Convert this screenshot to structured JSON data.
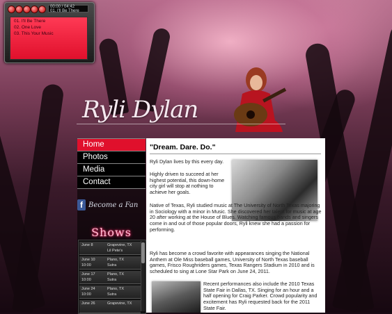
{
  "player": {
    "buttons": [
      "prev",
      "play",
      "pause",
      "stop",
      "next"
    ],
    "display_time": "00:00 / 04:42",
    "display_track": "01. I'll Be There",
    "playlist": [
      "01. I'll Be There",
      "02. One Love",
      "03. This Your Music"
    ]
  },
  "site": {
    "title": "Ryli Dylan"
  },
  "nav": {
    "items": [
      "Home",
      "Photos",
      "Media",
      "Contact"
    ]
  },
  "social": {
    "fan_label": "Become a Fan",
    "fb_letter": "f"
  },
  "shows": {
    "title": "Shows",
    "items": [
      {
        "date": "June 8",
        "time": "",
        "place": "Grapevine, TX",
        "venue": "Lil Pete's"
      },
      {
        "date": "June 10",
        "time": "10:00",
        "place": "Plano, TX",
        "venue": "Sutra"
      },
      {
        "date": "June 17",
        "time": "10:00",
        "place": "Plano, TX",
        "venue": "Sutra"
      },
      {
        "date": "June 24",
        "time": "10:00",
        "place": "Plano, TX",
        "venue": "Sutra"
      },
      {
        "date": "June 26",
        "time": "",
        "place": "Grapevine, TX",
        "venue": ""
      }
    ]
  },
  "content": {
    "heading": "\"Dream. Dare. Do.\"",
    "p1": "Ryli Dylan lives by this every day.",
    "p2": "Highly driven to succeed at her highest potential, this down-home city girl will stop at nothing to achieve her goals.",
    "p3": "Native of Texas, Ryli studied music at The University of North Texas majoring in Sociology with a minor in Music. She discovered her talent for music at age 20 after working at the House of Blues. Watching famous bands and singers come in and out of those popular doors, Ryli knew she had a passion for performing.",
    "p4": "Ryli has become a crowd favorite with appearances singing the National Anthem at Ole Miss baseball games, University of North Texas baseball games, Frisco Roughriders games, Texas Rangers Stadium in 2010 and is scheduled to sing at Lone Star Park on June 24, 2011.",
    "p5": "Recent performances also include the 2010 Texas State Fair in Dallas, TX. Singing for an hour and a half opening for Craig Parker. Crowd popularity and excitement has Ryli requested back for the 2011 State Fair."
  },
  "colors": {
    "accent": "#e0102c",
    "shows_glow": "#ff2b6b",
    "facebook": "#3b5998"
  }
}
